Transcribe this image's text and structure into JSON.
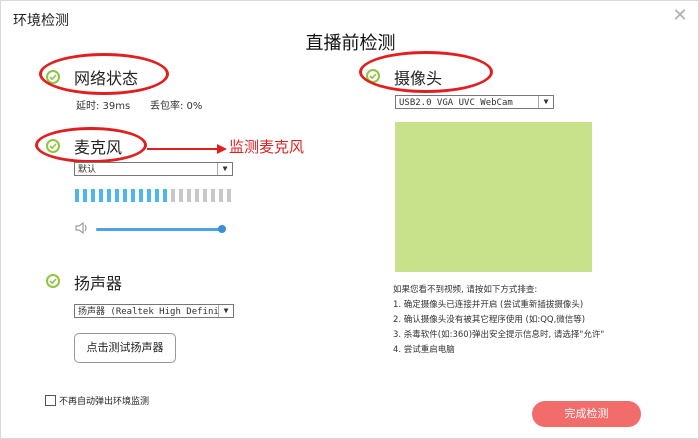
{
  "window": {
    "title": "环境检测",
    "close_icon": "close-icon"
  },
  "main_title": "直播前检测",
  "network": {
    "label": "网络状态",
    "latency": "延时: 39ms",
    "loss": "丢包率: 0%"
  },
  "microphone": {
    "label": "麦克风",
    "device": "默认",
    "level_active": 12,
    "level_total": 20
  },
  "annotation": "监测麦克风",
  "speaker": {
    "label": "扬声器",
    "device": "扬声器 (Realtek High Definition",
    "test_button": "点击测试扬声器"
  },
  "camera": {
    "label": "摄像头",
    "device": "USB2.0 VGA UVC WebCam",
    "tips": [
      "如果您看不到视频, 请按如下方式排查:",
      "1. 确定摄像头已连接并开启 (尝试重新插拔摄像头)",
      "2. 确认摄像头没有被其它程序使用 (如:QQ,微信等)",
      "3. 杀毒软件(如:360)弹出安全提示信息时, 请选择\"允许\"",
      "4. 尝试重启电脑"
    ]
  },
  "footer": {
    "no_popup_label": "不再自动弹出环境监测",
    "done_button": "完成检测"
  },
  "colors": {
    "accent_green": "#8dc63f",
    "level_blue": "#4fb7e6",
    "done_red": "#f26c6c",
    "annotation_red": "#e02020"
  }
}
